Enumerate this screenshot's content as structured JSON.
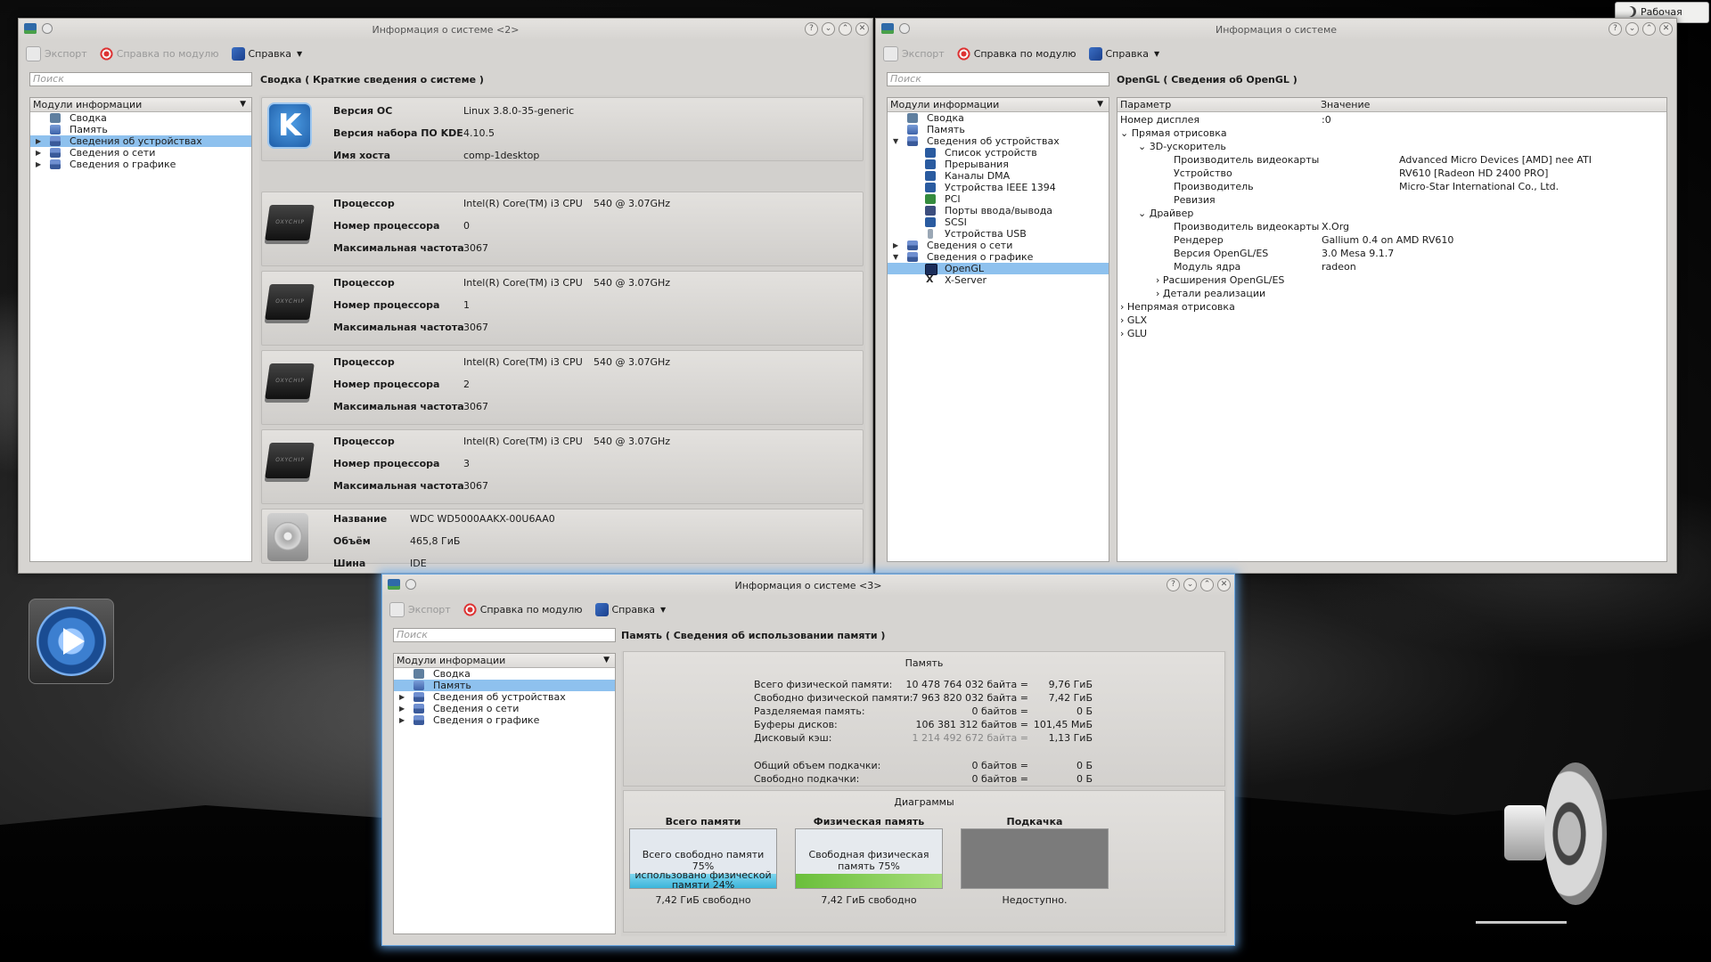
{
  "desktop": {
    "activity_label": "Рабочая"
  },
  "common": {
    "toolbar": {
      "export": "Экспорт",
      "module_help": "Справка по модулю",
      "help": "Справка"
    },
    "search_placeholder": "Поиск",
    "modules_header": "Модули информации"
  },
  "win_summary": {
    "title": "Информация о системе <2>",
    "pane_header": "Сводка  ( Краткие сведения о системе )",
    "tree": [
      "Сводка",
      "Память",
      "Сведения об устройствах",
      "Сведения о сети",
      "Сведения о графике"
    ],
    "os": {
      "keys": [
        "Версия ОС",
        "Версия набора ПО KDE",
        "Имя хоста"
      ],
      "values": [
        "Linux 3.8.0-35-generic",
        "4.10.5",
        "comp-1desktop"
      ]
    },
    "cpu_keys": [
      "Процессор",
      "Номер процессора",
      "Максимальная частота"
    ],
    "cpus": [
      {
        "name": "Intel(R) Core(TM) i3 CPU",
        "freq_label": "540  @ 3.07GHz",
        "number": "0",
        "max": "3067"
      },
      {
        "name": "Intel(R) Core(TM) i3 CPU",
        "freq_label": "540  @ 3.07GHz",
        "number": "1",
        "max": "3067"
      },
      {
        "name": "Intel(R) Core(TM) i3 CPU",
        "freq_label": "540  @ 3.07GHz",
        "number": "2",
        "max": "3067"
      },
      {
        "name": "Intel(R) Core(TM) i3 CPU",
        "freq_label": "540  @ 3.07GHz",
        "number": "3",
        "max": "3067"
      }
    ],
    "disk": {
      "keys": [
        "Название",
        "Объём",
        "Шина"
      ],
      "values": [
        "WDC WD5000AAKX-00U6AA0",
        "465,8 ГиБ",
        "IDE"
      ]
    }
  },
  "win_opengl": {
    "title": "Информация о системе",
    "pane_header": "OpenGL  ( Сведения об OpenGL )",
    "tree": [
      "Сводка",
      "Память",
      "Сведения об устройствах",
      "Список устройств",
      "Прерывания",
      "Каналы DMA",
      "Устройства IEEE 1394",
      "PCI",
      "Порты ввода/вывода",
      "SCSI",
      "Устройства USB",
      "Сведения о сети",
      "Сведения о графике",
      "OpenGL",
      "X-Server"
    ],
    "table_headers": [
      "Параметр",
      "Значение"
    ],
    "rows": [
      {
        "k": "Номер дисплея",
        "v": ":0"
      },
      {
        "k": "Прямая отрисовка",
        "v": ""
      },
      {
        "k": "3D-ускоритель",
        "v": ""
      },
      {
        "k": "Производитель видеокарты",
        "v": "Advanced Micro Devices [AMD] nee ATI"
      },
      {
        "k": "Устройство",
        "v": "RV610 [Radeon HD 2400 PRO]"
      },
      {
        "k": "Производитель",
        "v": "Micro-Star International Co., Ltd."
      },
      {
        "k": "Ревизия",
        "v": ""
      },
      {
        "k": "Драйвер",
        "v": ""
      },
      {
        "k": "Производитель видеокарты",
        "v": "X.Org"
      },
      {
        "k": "Рендерер",
        "v": "Gallium 0.4 on AMD RV610"
      },
      {
        "k": "Версия OpenGL/ES",
        "v": "3.0 Mesa 9.1.7"
      },
      {
        "k": "Модуль ядра",
        "v": "radeon"
      },
      {
        "k": "Расширения OpenGL/ES",
        "v": ""
      },
      {
        "k": "Детали реализации",
        "v": ""
      },
      {
        "k": "Непрямая отрисовка",
        "v": ""
      },
      {
        "k": "GLX",
        "v": ""
      },
      {
        "k": "GLU",
        "v": ""
      }
    ]
  },
  "win_memory": {
    "title": "Информация о системе <3>",
    "pane_header": "Память  ( Сведения об использовании памяти )",
    "tree": [
      "Сводка",
      "Память",
      "Сведения об устройствах",
      "Сведения о сети",
      "Сведения о графике"
    ],
    "section_title": "Память",
    "rows": [
      {
        "k": "Всего физической памяти:",
        "b": "10 478 764 032 байта =",
        "v": "9,76 ГиБ"
      },
      {
        "k": "Свободно физической памяти:",
        "b": "7 963 820 032 байта =",
        "v": "7,42 ГиБ"
      },
      {
        "k": "Разделяемая память:",
        "b": "0 байтов =",
        "v": "0 Б"
      },
      {
        "k": "Буферы дисков:",
        "b": "106 381 312 байтов =",
        "v": "101,45 МиБ"
      },
      {
        "k": "Дисковый кэш:",
        "b": "1 214 492 672 байта =",
        "v": "1,13 ГиБ"
      },
      {
        "k": "Общий объем подкачки:",
        "b": "0 байтов =",
        "v": "0 Б"
      },
      {
        "k": "Свободно подкачки:",
        "b": "0 байтов =",
        "v": "0 Б"
      }
    ],
    "diagrams_title": "Диаграммы",
    "diagrams": [
      {
        "title": "Всего памяти",
        "top_text": "Всего свободно памяти 75%",
        "bottom_text": "использовано физической памяти 24%",
        "free_fraction": 0.75,
        "footer": "7,42 ГиБ свободно"
      },
      {
        "title": "Физическая память",
        "top_text": "Свободная физическая память 75%",
        "bottom_text": "",
        "free_fraction": 0.75,
        "footer": "7,42 ГиБ свободно"
      },
      {
        "title": "Подкачка",
        "top_text": "",
        "bottom_text": "",
        "free_fraction": 0,
        "footer": "Недоступно."
      }
    ]
  }
}
